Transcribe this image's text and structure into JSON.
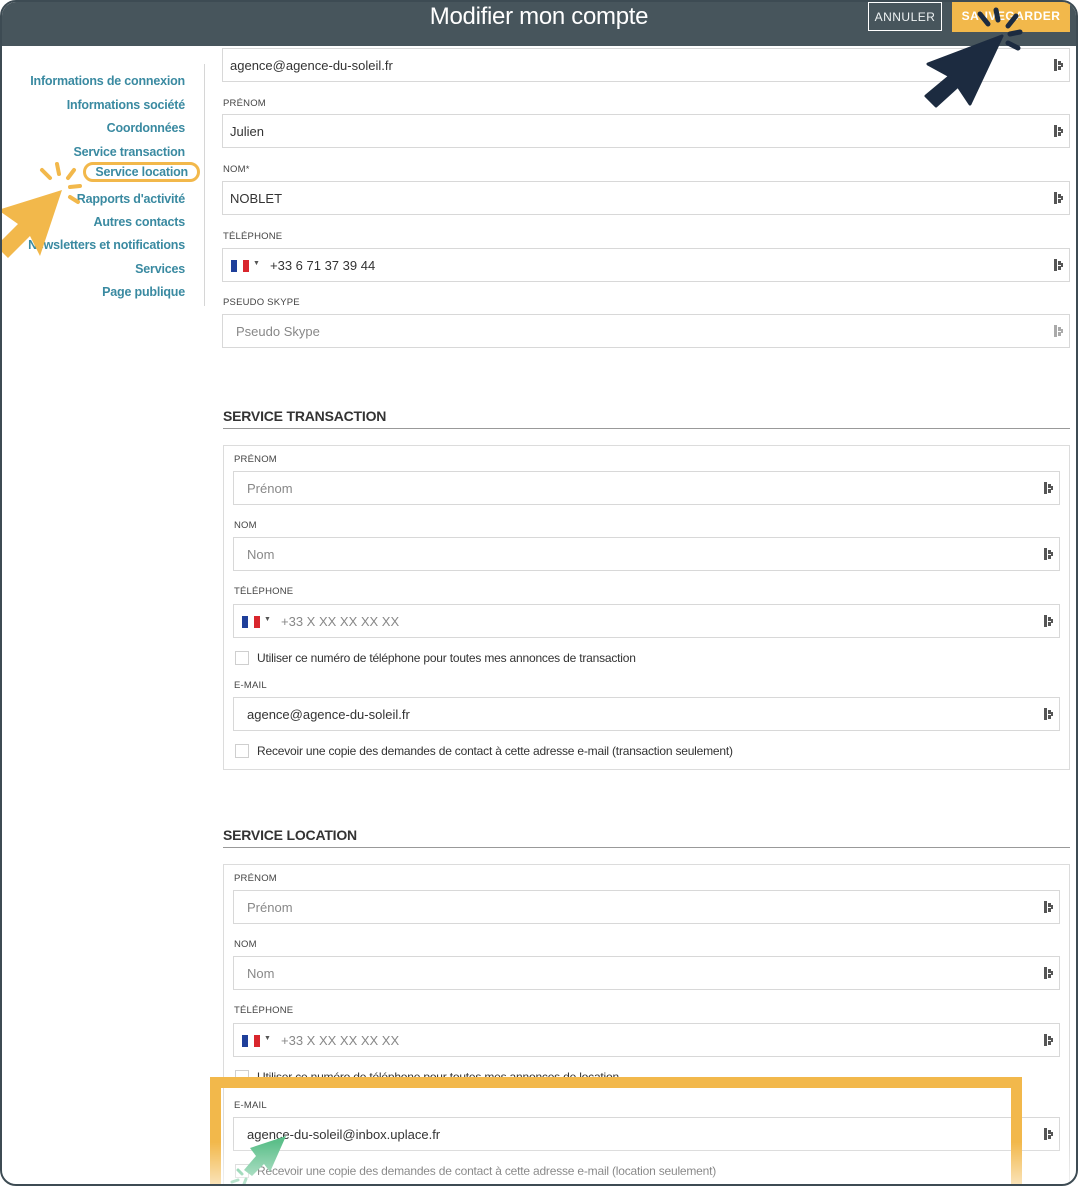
{
  "header": {
    "title": "Modifier mon compte",
    "cancel_label": "ANNULER",
    "save_label": "SAUVEGARDER"
  },
  "sidebar": {
    "items": [
      {
        "label": "Informations de connexion"
      },
      {
        "label": "Informations société"
      },
      {
        "label": "Coordonnées"
      },
      {
        "label": "Service transaction"
      },
      {
        "label": "Service location",
        "active": true
      },
      {
        "label": "Rapports d'activité"
      },
      {
        "label": "Autres contacts"
      },
      {
        "label": "Newsletters et notifications"
      },
      {
        "label": "Services"
      },
      {
        "label": "Page publique"
      }
    ]
  },
  "account": {
    "email_value": "agence@agence-du-soleil.fr",
    "prenom_label": "PRÉNOM",
    "prenom_value": "Julien",
    "nom_label": "NOM*",
    "nom_value": "NOBLET",
    "telephone_label": "TÉLÉPHONE",
    "telephone_value": "+33 6 71 37 39 44",
    "skype_label": "PSEUDO SKYPE",
    "skype_placeholder": "Pseudo Skype"
  },
  "transaction": {
    "title": "SERVICE TRANSACTION",
    "prenom_label": "PRÉNOM",
    "prenom_placeholder": "Prénom",
    "nom_label": "NOM",
    "nom_placeholder": "Nom",
    "telephone_label": "TÉLÉPHONE",
    "telephone_placeholder": "+33 X XX XX XX XX",
    "use_phone_label": "Utiliser ce numéro de téléphone pour toutes mes annonces de transaction",
    "email_label": "E-MAIL",
    "email_value": "agence@agence-du-soleil.fr",
    "copy_label": "Recevoir une copie des demandes de contact à cette adresse e-mail (transaction seulement)"
  },
  "location": {
    "title": "SERVICE LOCATION",
    "prenom_label": "PRÉNOM",
    "prenom_placeholder": "Prénom",
    "nom_label": "NOM",
    "nom_placeholder": "Nom",
    "telephone_label": "TÉLÉPHONE",
    "telephone_placeholder": "+33 X XX XX XX XX",
    "use_phone_label": "Utiliser ce numéro de téléphone pour toutes mes annonces de location",
    "email_label": "E-MAIL",
    "email_value": "agence-du-soleil@inbox.uplace.fr",
    "copy_label": "Recevoir une copie des demandes de contact à cette adresse e-mail (location seulement)"
  },
  "colors": {
    "header_bg": "#47555c",
    "accent_yellow": "#f2b84b",
    "link_teal": "#3a8aa1",
    "cursor_navy": "#1c2b40",
    "cursor_green": "#5cbf8a"
  },
  "icons": {
    "field_key": "key-icon",
    "flag": "flag-fr-icon",
    "cursor": "pointer-cursor-icon"
  }
}
